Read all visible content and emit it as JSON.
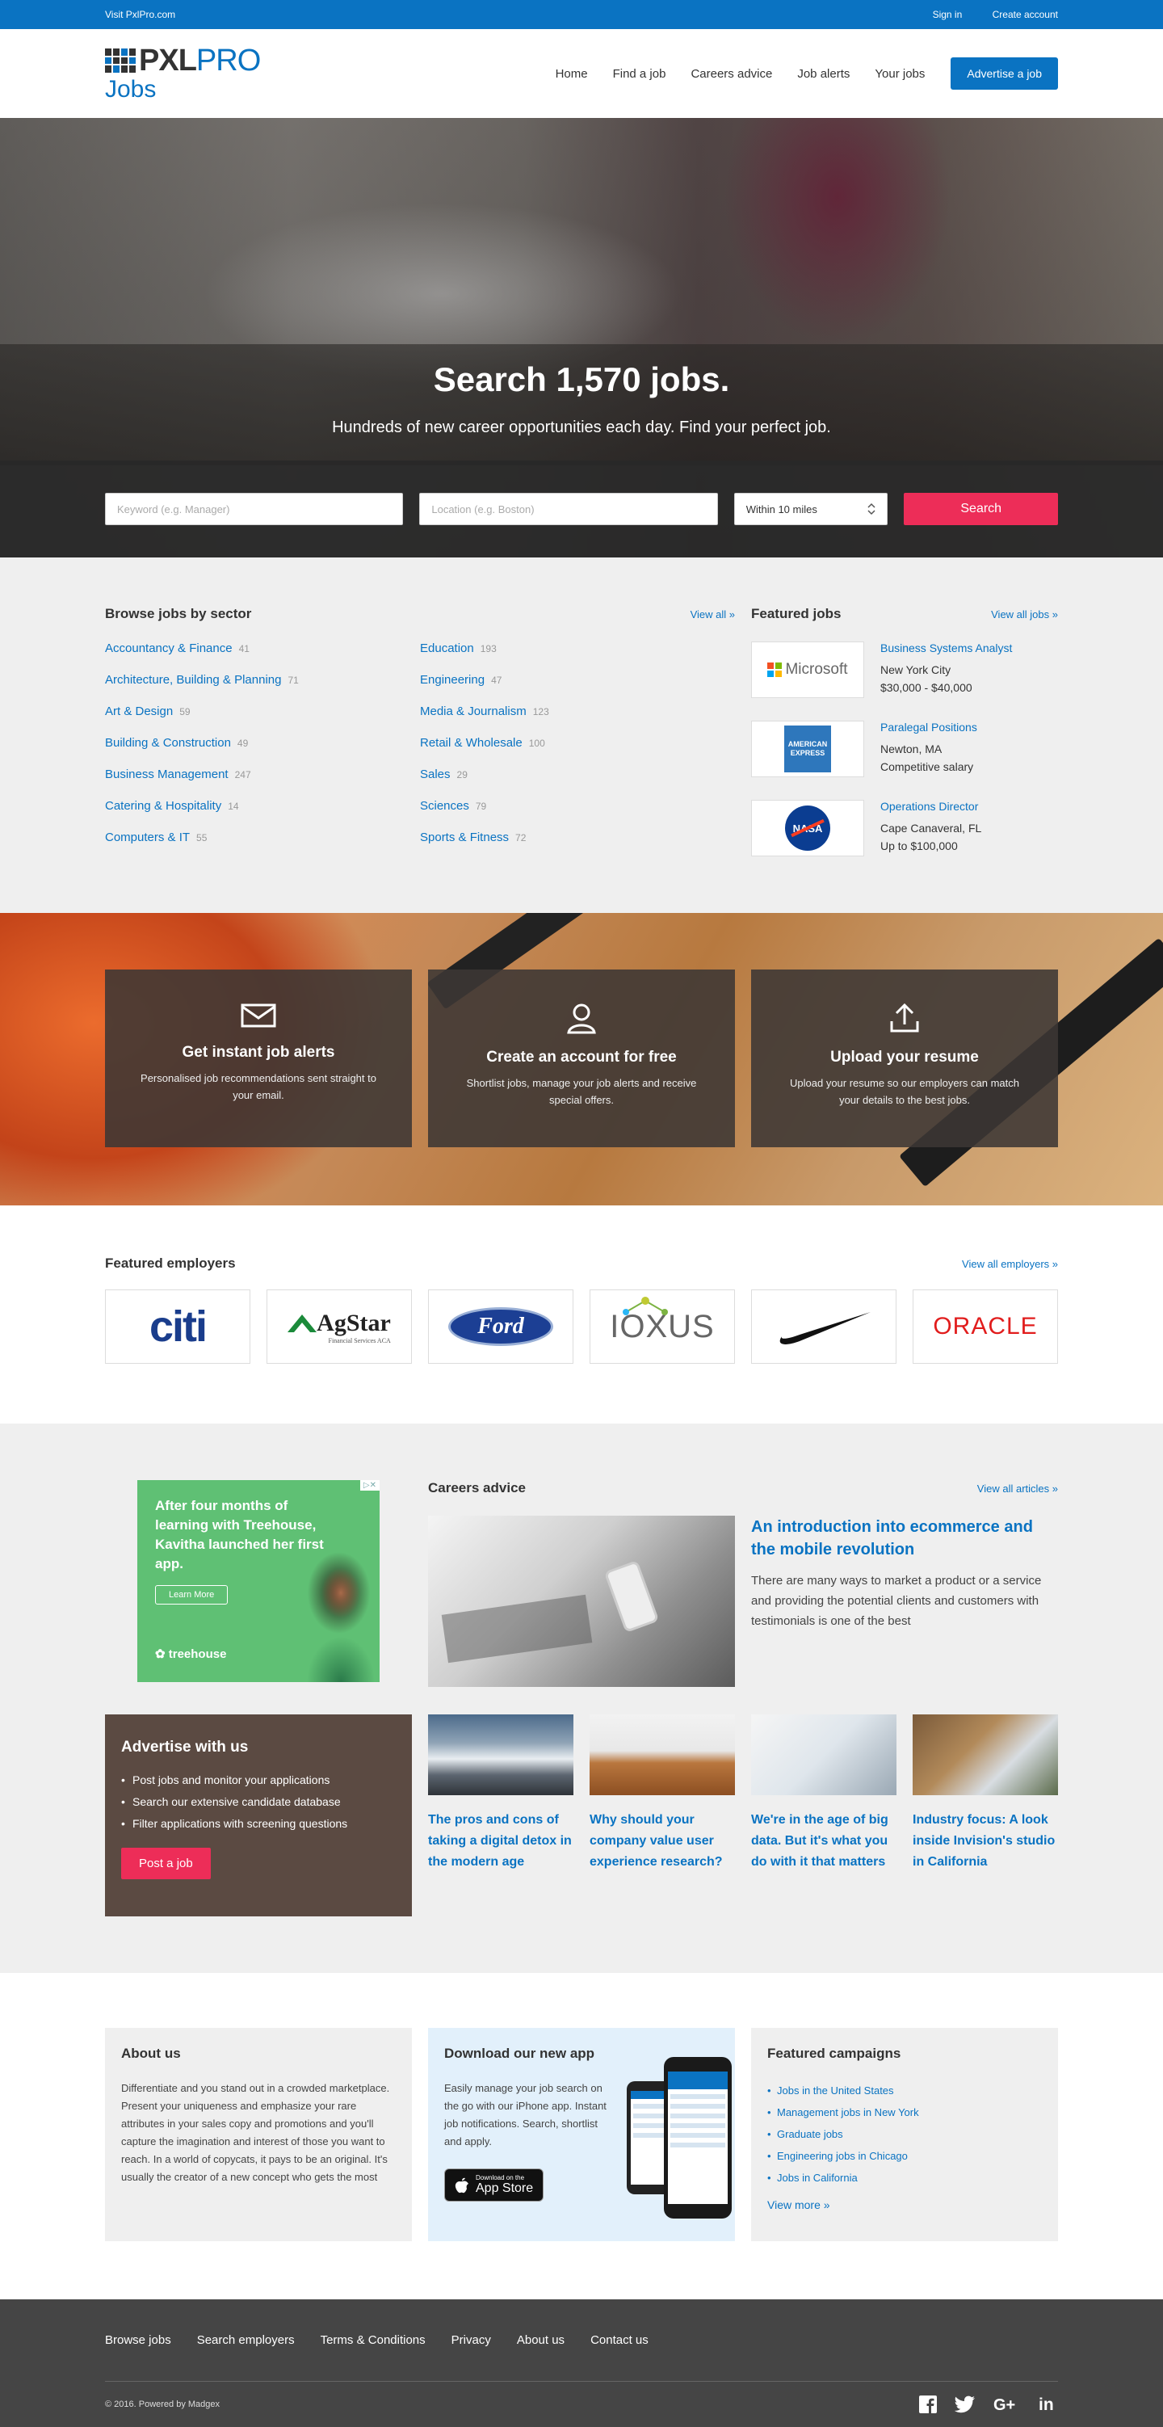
{
  "topbar": {
    "visit": "Visit PxlPro.com",
    "sign_in": "Sign in",
    "create_account": "Create account"
  },
  "header": {
    "logo_pxl": "PXL",
    "logo_pro": "PRO",
    "logo_jobs": "Jobs",
    "nav": [
      "Home",
      "Find a job",
      "Careers advice",
      "Job alerts",
      "Your jobs"
    ],
    "advertise": "Advertise a job"
  },
  "hero": {
    "title": "Search 1,570 jobs.",
    "subtitle": "Hundreds of new career opportunities each day. Find your perfect job.",
    "keyword_placeholder": "Keyword (e.g. Manager)",
    "location_placeholder": "Location (e.g. Boston)",
    "radius": "Within 10 miles",
    "search": "Search"
  },
  "browse": {
    "title": "Browse jobs by sector",
    "view_all": "View all »",
    "col1": [
      {
        "name": "Accountancy & Finance",
        "count": "41"
      },
      {
        "name": "Architecture, Building & Planning",
        "count": "71"
      },
      {
        "name": "Art & Design",
        "count": "59"
      },
      {
        "name": "Building & Construction",
        "count": "49"
      },
      {
        "name": "Business Management",
        "count": "247"
      },
      {
        "name": "Catering & Hospitality",
        "count": "14"
      },
      {
        "name": "Computers & IT",
        "count": "55"
      }
    ],
    "col2": [
      {
        "name": "Education",
        "count": "193"
      },
      {
        "name": "Engineering",
        "count": "47"
      },
      {
        "name": "Media & Journalism",
        "count": "123"
      },
      {
        "name": "Retail & Wholesale",
        "count": "100"
      },
      {
        "name": "Sales",
        "count": "29"
      },
      {
        "name": "Sciences",
        "count": "79"
      },
      {
        "name": "Sports & Fitness",
        "count": "72"
      }
    ]
  },
  "featured_jobs": {
    "title": "Featured jobs",
    "view_all": "View all jobs »",
    "items": [
      {
        "logo": "Microsoft",
        "title": "Business Systems Analyst",
        "location": "New York City",
        "salary": "$30,000 - $40,000"
      },
      {
        "logo": "AMERICAN EXPRESS",
        "title": "Paralegal Positions",
        "location": "Newton, MA",
        "salary": "Competitive salary"
      },
      {
        "logo": "NASA",
        "title": "Operations Director",
        "location": "Cape Canaveral, FL",
        "salary": "Up to $100,000"
      }
    ]
  },
  "promo": [
    {
      "icon": "envelope-icon",
      "title": "Get instant job alerts",
      "body": "Personalised job recommendations sent straight to your email."
    },
    {
      "icon": "user-icon",
      "title": "Create an account for free",
      "body": "Shortlist jobs, manage your job alerts and receive special offers."
    },
    {
      "icon": "upload-icon",
      "title": "Upload your resume",
      "body": "Upload your resume so our employers can match your details to the best jobs."
    }
  ],
  "employers": {
    "title": "Featured employers",
    "view_all": "View all employers »",
    "logos": [
      "citi",
      "AgStar",
      "Financial Services ACA",
      "Ford",
      "IOXUS",
      "ORACLE"
    ]
  },
  "careers": {
    "title": "Careers advice",
    "view_all": "View all articles »",
    "ad": {
      "text": "After four months of learning with Treehouse, Kavitha launched her first app.",
      "button": "Learn More",
      "brand": "treehouse",
      "close": "▷✕"
    },
    "feature": {
      "title": "An introduction into ecommerce and the mobile revolution",
      "body": "There are many ways to market a product or a service and providing the potential clients and customers with testimonials is one of the best"
    },
    "advertise": {
      "title": "Advertise with us",
      "items": [
        "Post jobs and monitor your applications",
        "Search our extensive candidate database",
        "Filter applications with screening questions"
      ],
      "button": "Post a job"
    },
    "articles": [
      {
        "title": "The pros and cons of taking a digital detox in the modern age"
      },
      {
        "title": "Why should your company value user experience research?"
      },
      {
        "title": "We're in the age of big data. But it's what you do with it that matters"
      },
      {
        "title": "Industry focus: A look inside Invision's studio in California"
      }
    ]
  },
  "about": {
    "title": "About us",
    "body": "Differentiate and you stand out in a crowded marketplace. Present your uniqueness and emphasize your rare attributes in your sales copy and promotions and you'll capture the imagination and interest of those you want to reach. In a world of copycats, it pays to be an original. It's usually the creator of a new concept who gets the most"
  },
  "app": {
    "title": "Download our new app",
    "body": "Easily manage your job search on the go with our iPhone app. Instant job notifications. Search, shortlist and apply.",
    "store_small": "Download on the",
    "store_big": "App Store"
  },
  "campaigns": {
    "title": "Featured campaigns",
    "items": [
      "Jobs in the United States",
      "Management jobs in New York",
      "Graduate jobs",
      "Engineering jobs in Chicago",
      "Jobs in California"
    ],
    "more": "View more »"
  },
  "footer": {
    "links": [
      "Browse jobs",
      "Search employers",
      "Terms & Conditions",
      "Privacy",
      "About us",
      "Contact us"
    ],
    "copyright": "© 2016. Powered by Madgex",
    "social": [
      "facebook-icon",
      "twitter-icon",
      "google-plus-icon",
      "linkedin-icon"
    ]
  },
  "colors": {
    "brand_blue": "#0a73c2",
    "accent_pink": "#ed2d58"
  }
}
